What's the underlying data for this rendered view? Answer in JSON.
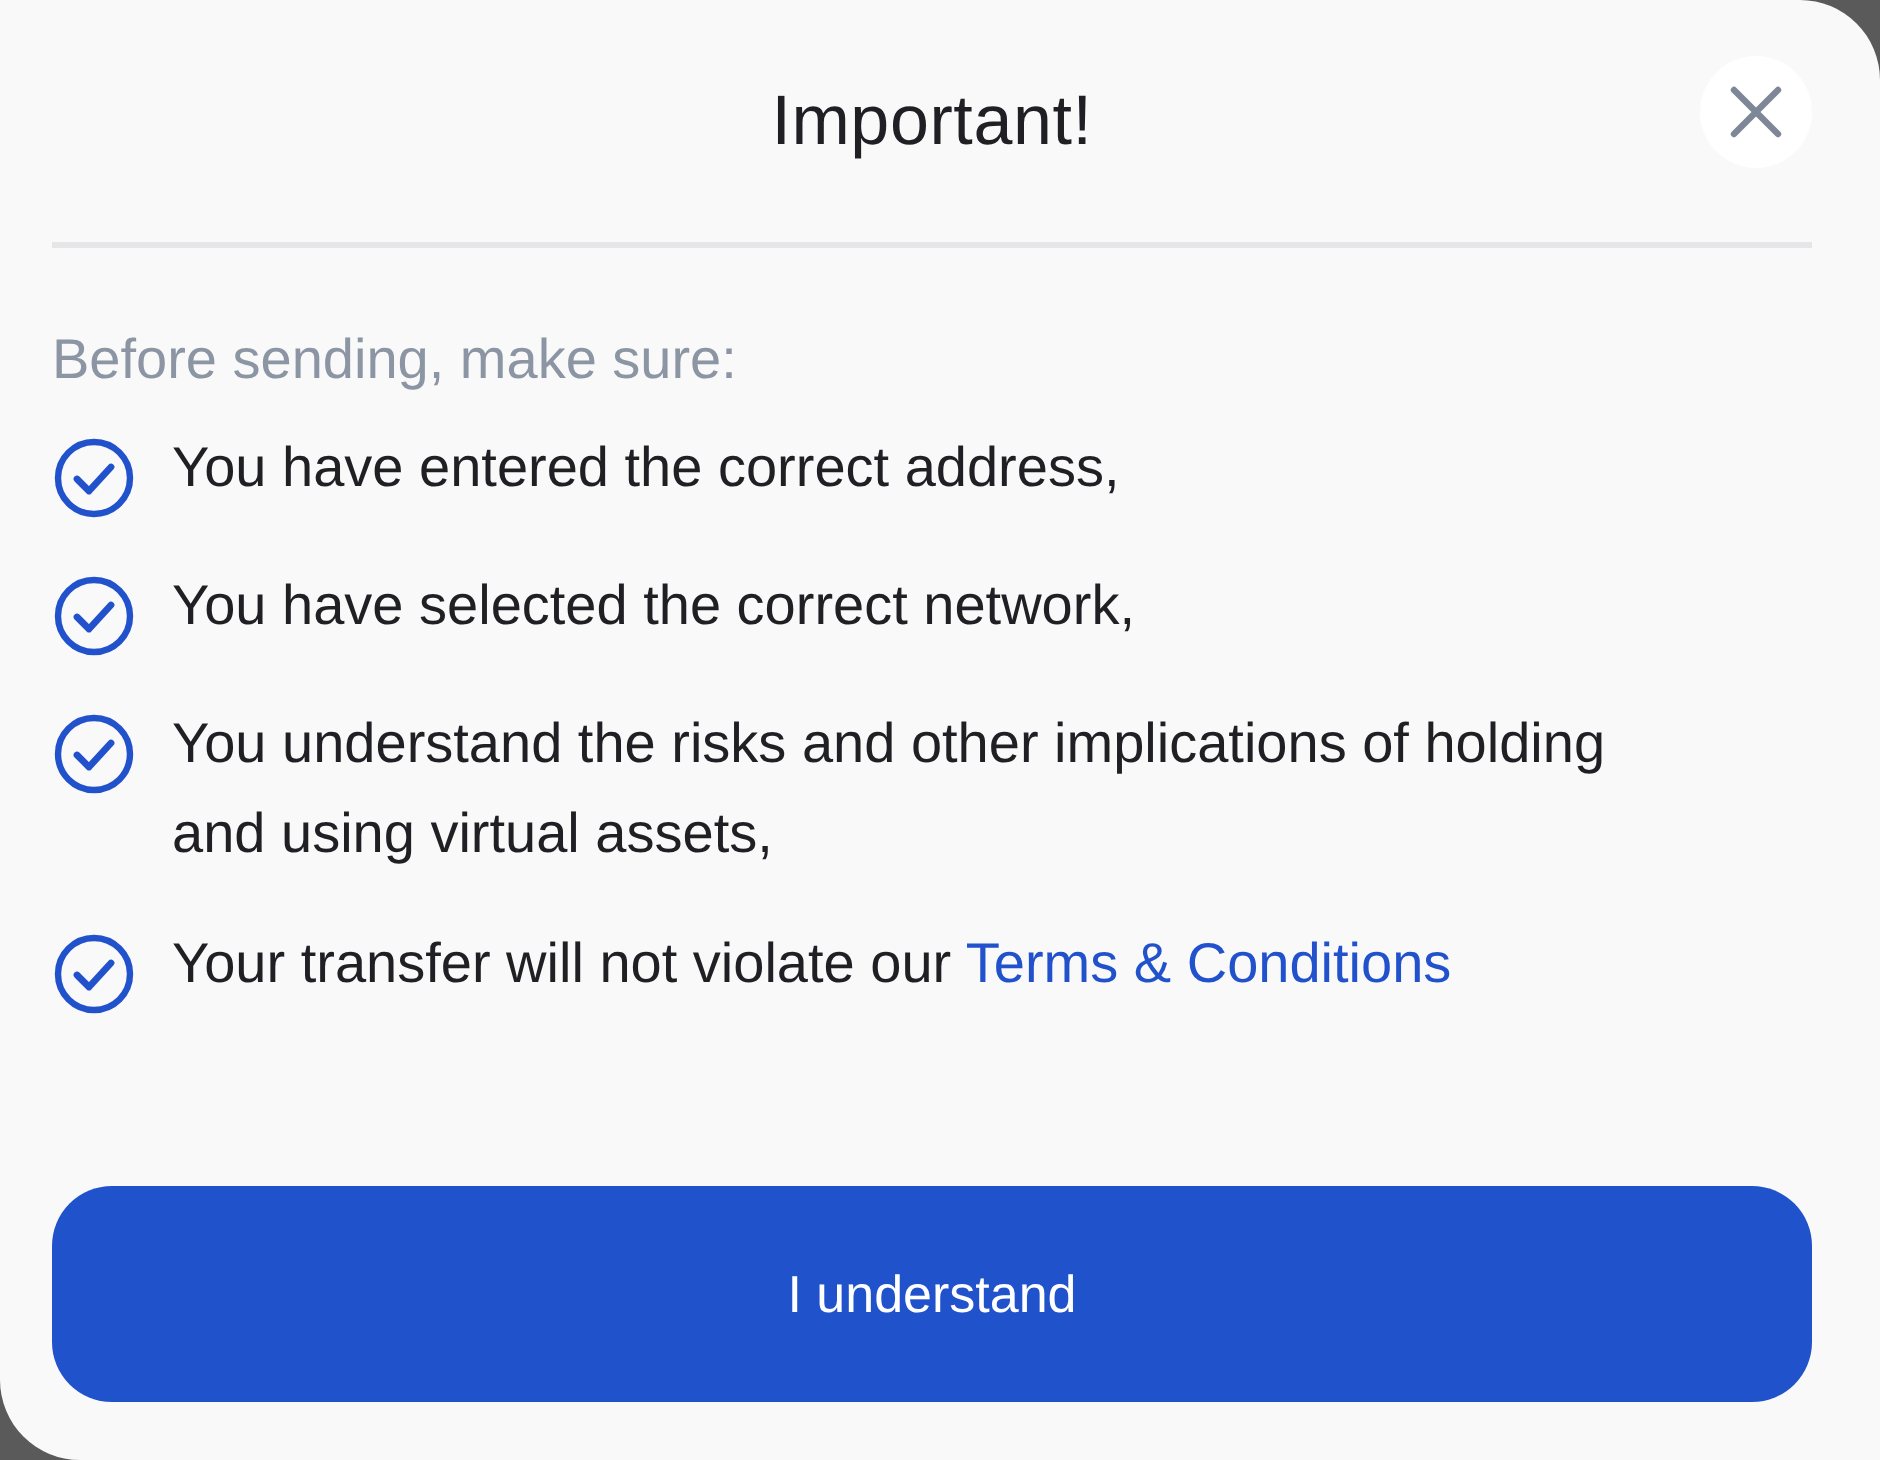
{
  "dialog": {
    "title": "Important!",
    "intro": "Before sending, make sure:",
    "items": [
      {
        "text": "You have entered the correct address,",
        "checked": true
      },
      {
        "text": "You have selected the correct network,",
        "checked": true
      },
      {
        "text": "You understand the risks and other implications of holding and using virtual assets,",
        "checked": true
      },
      {
        "text": "Your transfer will not violate our",
        "link": "Terms & Conditions",
        "checked": true
      }
    ],
    "button": "I understand"
  }
}
